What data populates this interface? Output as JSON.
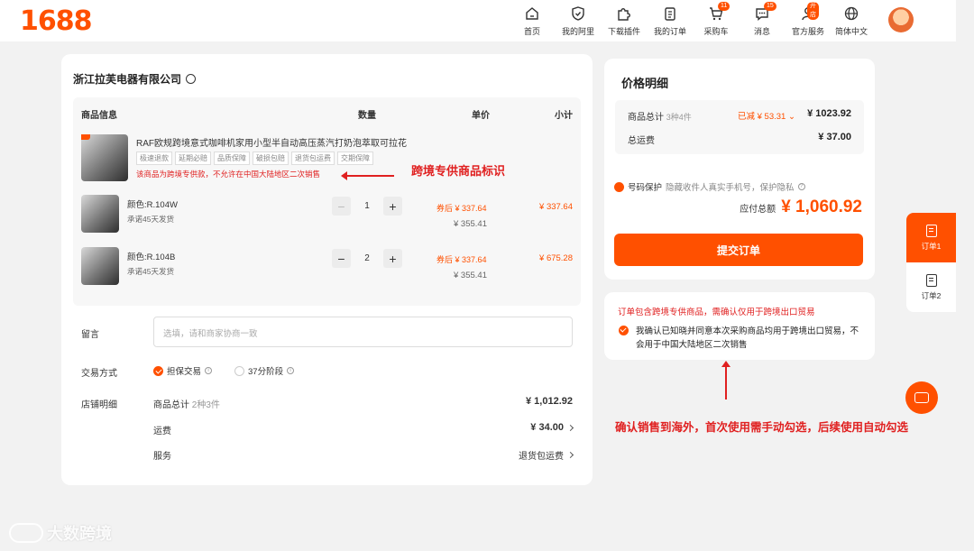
{
  "header": {
    "logo": "1688",
    "nav": [
      {
        "label": "首页",
        "icon": "home-icon"
      },
      {
        "label": "我的阿里",
        "icon": "shield-icon"
      },
      {
        "label": "下载插件",
        "icon": "puzzle-icon"
      },
      {
        "label": "我的订单",
        "icon": "clipboard-icon"
      },
      {
        "label": "采购车",
        "icon": "cart-icon",
        "badge": "11"
      },
      {
        "label": "消息",
        "icon": "message-icon",
        "badge": "15"
      },
      {
        "label": "官方服务",
        "icon": "person-icon",
        "badge": "开店"
      },
      {
        "label": "简体中文",
        "icon": "globe-icon"
      }
    ]
  },
  "store": {
    "company": "浙江拉芙电器有限公司",
    "table_headers": {
      "info": "商品信息",
      "qty": "数量",
      "price": "单价",
      "subtotal": "小计"
    },
    "product": {
      "title": "RAF欧规跨境意式咖啡机家用小型半自动高压蒸汽打奶泡萃取可拉花",
      "tags": [
        "极速退款",
        "延期必赔",
        "品质保障",
        "破损包赔",
        "退货包运费",
        "交期保障"
      ],
      "warning": "该商品为跨境专供款，不允许在中国大陆地区二次销售"
    },
    "skus": [
      {
        "name": "颜色:R.104W",
        "ship": "承诺45天发货",
        "qty": "1",
        "price_after": "券后 ¥ 337.64",
        "price_orig": "¥ 355.41",
        "subtotal": "¥ 337.64"
      },
      {
        "name": "颜色:R.104B",
        "ship": "承诺45天发货",
        "qty": "2",
        "price_after": "券后 ¥ 337.64",
        "price_orig": "¥ 355.41",
        "subtotal": "¥ 675.28"
      }
    ],
    "message_label": "留言",
    "message_placeholder": "选填，请和商家协商一致",
    "trade_label": "交易方式",
    "trade_options": [
      "担保交易",
      "37分阶段"
    ],
    "detail_label": "店铺明细",
    "detail": {
      "goods_total_label": "商品总计",
      "goods_total_count": "2种3件",
      "goods_total_value": "¥ 1,012.92",
      "shipping_label": "运费",
      "shipping_value": "¥ 34.00",
      "service_label": "服务",
      "service_value": "退货包运费"
    }
  },
  "annotations": {
    "cross_border_mark": "跨境专供商品标识",
    "auto_check_note": "确认销售到海外，首次使用需手动勾选，后续使用自动勾选"
  },
  "price_panel": {
    "title": "价格明细",
    "goods_total_label": "商品总计",
    "goods_total_count": "3种4件",
    "discount": "已减 ¥ 53.31",
    "goods_total_value": "¥ 1023.92",
    "shipping_label": "总运费",
    "shipping_value": "¥ 37.00",
    "protect_label": "号码保护",
    "protect_desc": "隐藏收件人真实手机号，保护隐私",
    "payable_label": "应付总额",
    "payable_value": "¥ 1,060.92",
    "submit_label": "提交订单"
  },
  "cross_border": {
    "title": "订单包含跨境专供商品，需确认仅用于跨境出口贸易",
    "confirm_text": "我确认已知晓并同意本次采购商品均用于跨境出口贸易，不会用于中国大陆地区二次销售"
  },
  "side_tabs": [
    "订单1",
    "订单2"
  ],
  "watermark": "大数跨境",
  "colors": {
    "accent": "#ff5000",
    "annotation": "#e02020"
  }
}
